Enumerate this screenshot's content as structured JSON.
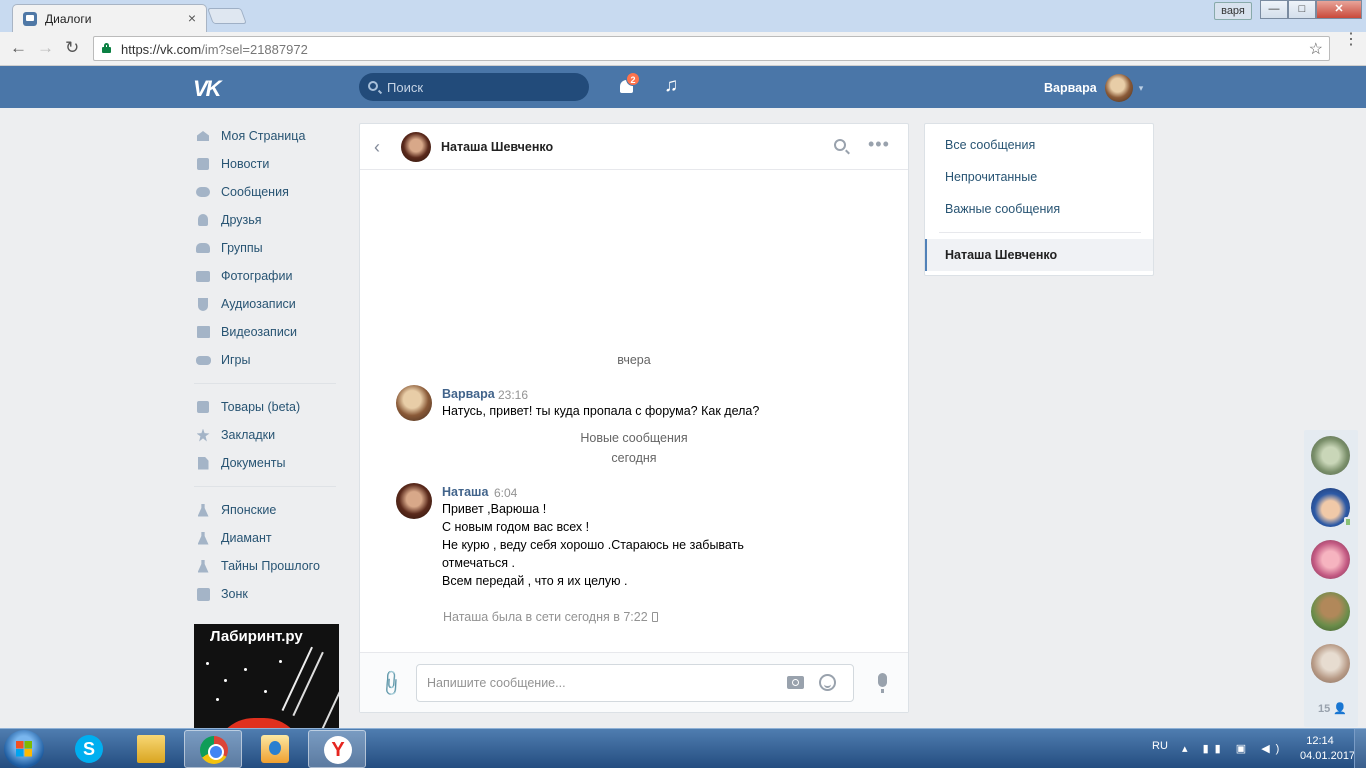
{
  "browser": {
    "tab_title": "Диалоги",
    "tab_close": "×",
    "url_host": "https://vk.com",
    "url_path": "/im?sel=21887972",
    "window_user": "варя",
    "buttons": {
      "back": "←",
      "forward": "→",
      "reload": "↻",
      "star": "☆",
      "menu": "⋮",
      "min": "—",
      "max": "□",
      "close": "✕"
    }
  },
  "vk_header": {
    "logo": "VK",
    "search_placeholder": "Поиск",
    "notifications_count": "2",
    "music_icon": "♫",
    "user_name": "Варвара",
    "caret": "▾"
  },
  "left_menu": {
    "main": [
      {
        "label": "Моя Страница",
        "icon": "home-icon"
      },
      {
        "label": "Новости",
        "icon": "news-icon"
      },
      {
        "label": "Сообщения",
        "icon": "messages-icon"
      },
      {
        "label": "Друзья",
        "icon": "friends-icon"
      },
      {
        "label": "Группы",
        "icon": "groups-icon"
      },
      {
        "label": "Фотографии",
        "icon": "camera-icon"
      },
      {
        "label": "Аудиозаписи",
        "icon": "music-icon"
      },
      {
        "label": "Видеозаписи",
        "icon": "video-icon"
      },
      {
        "label": "Игры",
        "icon": "gamepad-icon"
      }
    ],
    "secondary": [
      {
        "label": "Товары (beta)",
        "icon": "bag-icon"
      },
      {
        "label": "Закладки",
        "icon": "star-icon"
      },
      {
        "label": "Документы",
        "icon": "document-icon"
      }
    ],
    "apps": [
      {
        "label": "Японские",
        "icon": "flask-icon"
      },
      {
        "label": "Диамант",
        "icon": "flask-icon"
      },
      {
        "label": "Тайны Прошлого",
        "icon": "flask-icon"
      },
      {
        "label": "Зонк",
        "icon": "app-icon"
      }
    ],
    "ad_title": "Лабиринт.ру"
  },
  "chat": {
    "contact_name": "Наташа Шевченко",
    "back_icon": "‹",
    "more_icon": "•••",
    "date_yesterday": "вчера",
    "msg1": {
      "author": "Варвара",
      "time": "23:16",
      "text": "Натусь, привет! ты куда пропала с форума? Как дела?"
    },
    "new_messages_label": "Новые сообщения",
    "date_today": "сегодня",
    "msg2": {
      "author": "Наташа",
      "time": "6:04",
      "lines": [
        "Привет ,Варюша !",
        "С новым годом вас всех !",
        "Не курю , веду себя хорошо .Стараюсь не забывать",
        "отмечаться .",
        "Всем передай , что я их целую ."
      ]
    },
    "online_status": "Наташа была в сети сегодня в 7:22",
    "input_placeholder": "Напишите сообщение...",
    "attach_icon": "📎"
  },
  "right_menu": {
    "items": [
      "Все сообщения",
      "Непрочитанные",
      "Важные сообщения"
    ],
    "active": "Наташа Шевченко"
  },
  "chatbar": {
    "count": "15 👤"
  },
  "taskbar": {
    "skype_letter": "S",
    "yandex_letter": "Y",
    "lang": "RU",
    "tray": "▴ ▮▮ ▣ ◀)",
    "time": "12:14",
    "date": "04.01.2017"
  }
}
